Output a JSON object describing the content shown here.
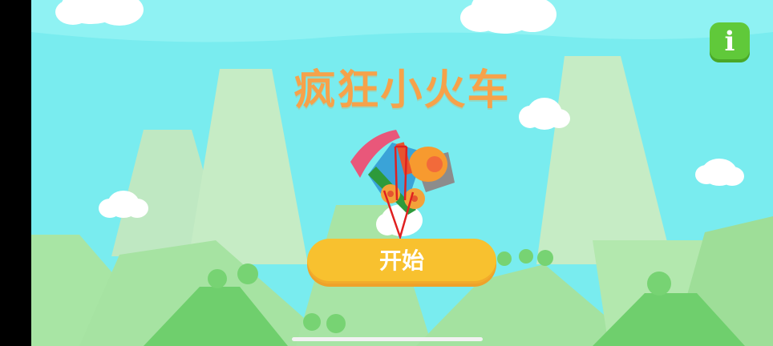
{
  "game": {
    "title": "疯狂小火车",
    "start_label": "开始",
    "info_icon": "i"
  },
  "colors": {
    "sky": "#79ecef",
    "title": "#f6a24a",
    "start_button": "#f8c12f",
    "info_button": "#60c93a"
  }
}
